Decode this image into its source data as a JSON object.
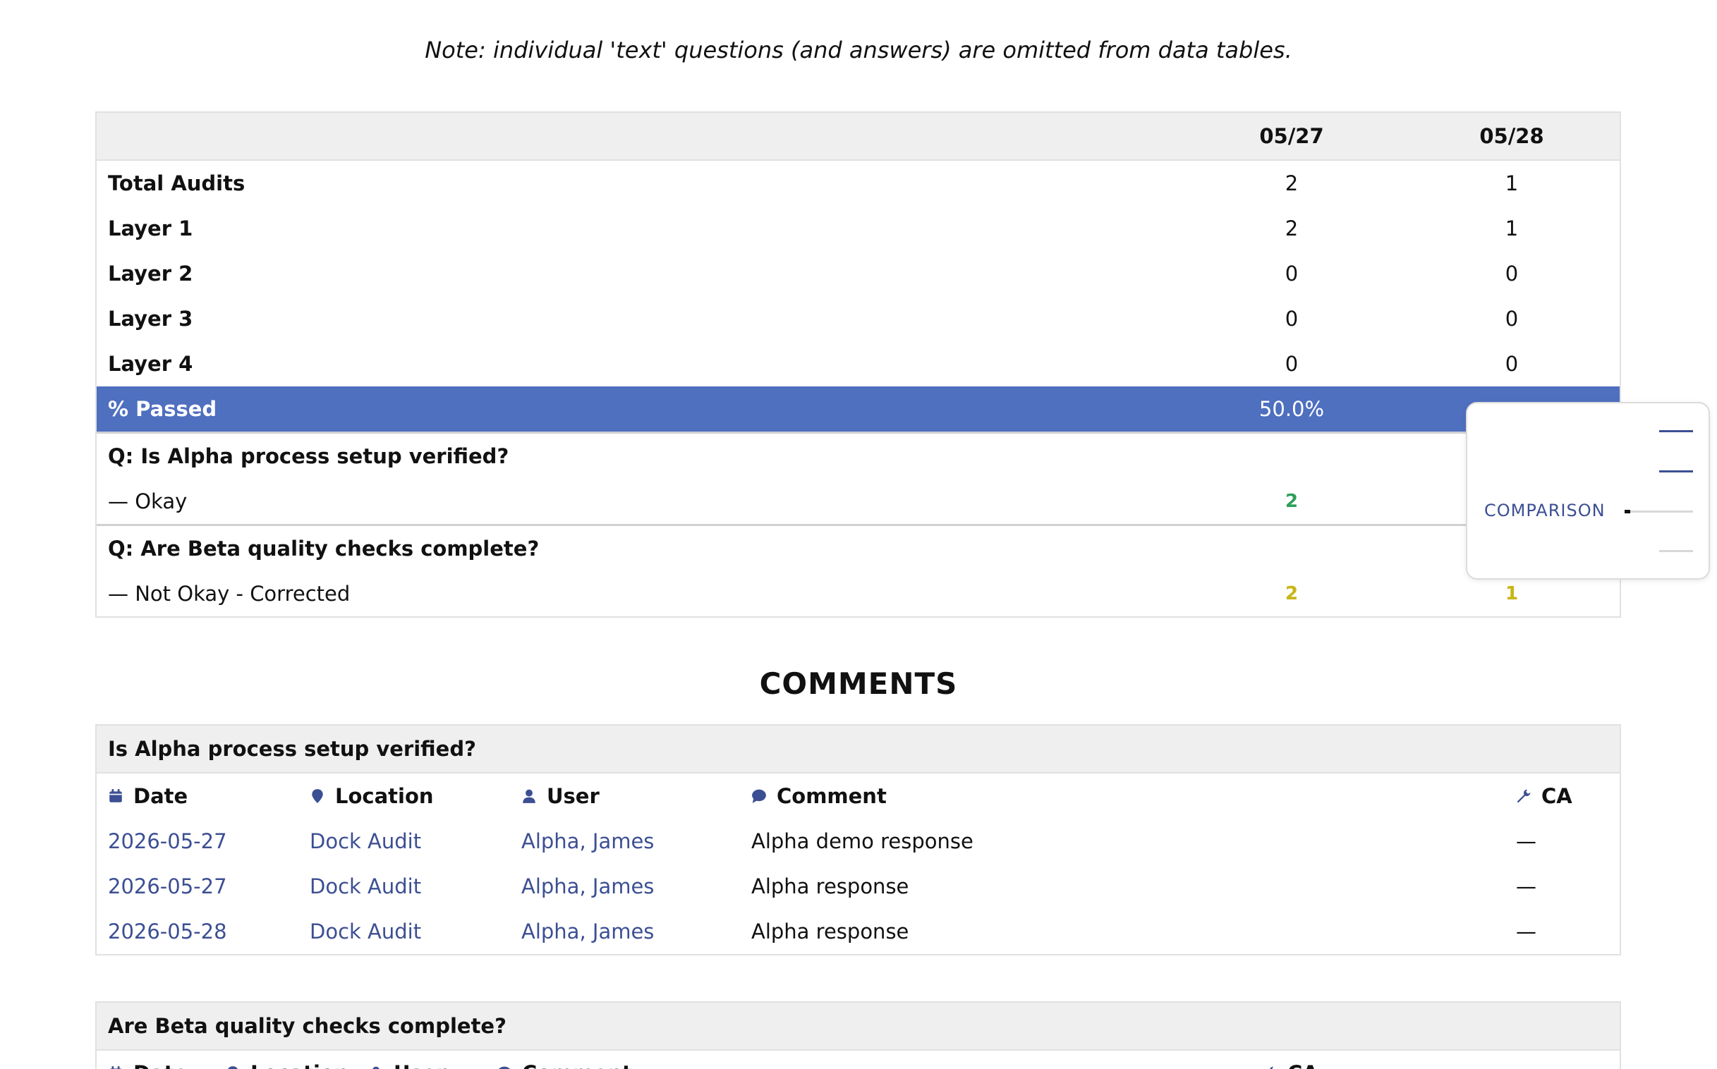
{
  "note": "Note: individual 'text' questions (and answers) are omitted from data tables.",
  "summary": {
    "columns": [
      "05/27",
      "05/28"
    ],
    "rows": [
      {
        "label": "Total Audits",
        "v1": "2",
        "v2": "1"
      },
      {
        "label": "Layer 1",
        "v1": "2",
        "v2": "1"
      },
      {
        "label": "Layer 2",
        "v1": "0",
        "v2": "0"
      },
      {
        "label": "Layer 3",
        "v1": "0",
        "v2": "0"
      },
      {
        "label": "Layer 4",
        "v1": "0",
        "v2": "0"
      }
    ],
    "passed": {
      "label": "% Passed",
      "v1": "50.0%"
    },
    "questions": [
      {
        "question": "Q: Is Alpha process setup verified?",
        "answer": "— Okay",
        "v1": "2",
        "v2": ""
      },
      {
        "question": "Q: Are Beta quality checks complete?",
        "answer": "— Not Okay - Corrected",
        "v1": "2",
        "v2": "1"
      }
    ]
  },
  "popover": {
    "label": "COMPARISON"
  },
  "comments": {
    "title": "COMMENTS",
    "headers": {
      "date": "Date",
      "location": "Location",
      "user": "User",
      "comment": "Comment",
      "ca": "CA"
    },
    "groups": [
      {
        "title": "Is Alpha process setup verified?",
        "rows": [
          {
            "date": "2026-05-27",
            "location": "Dock Audit",
            "user": "Alpha, James",
            "comment": "Alpha demo response",
            "ca": "—"
          },
          {
            "date": "2026-05-27",
            "location": "Dock Audit",
            "user": "Alpha, James",
            "comment": "Alpha response",
            "ca": "—"
          },
          {
            "date": "2026-05-28",
            "location": "Dock Audit",
            "user": "Alpha, James",
            "comment": "Alpha response",
            "ca": "—"
          }
        ]
      },
      {
        "title": "Are Beta quality checks complete?",
        "rows": []
      }
    ]
  },
  "colors": {
    "accent": "#4f6fbf",
    "link": "#3c4f93",
    "ok_green": "#2e9e5a",
    "corrected_yellow": "#c7b51a",
    "header_bg": "#efefef"
  },
  "icons": {
    "date": "calendar-icon",
    "location": "map-pin-icon",
    "user": "user-icon",
    "comment": "comment-icon",
    "ca": "wrench-icon"
  }
}
